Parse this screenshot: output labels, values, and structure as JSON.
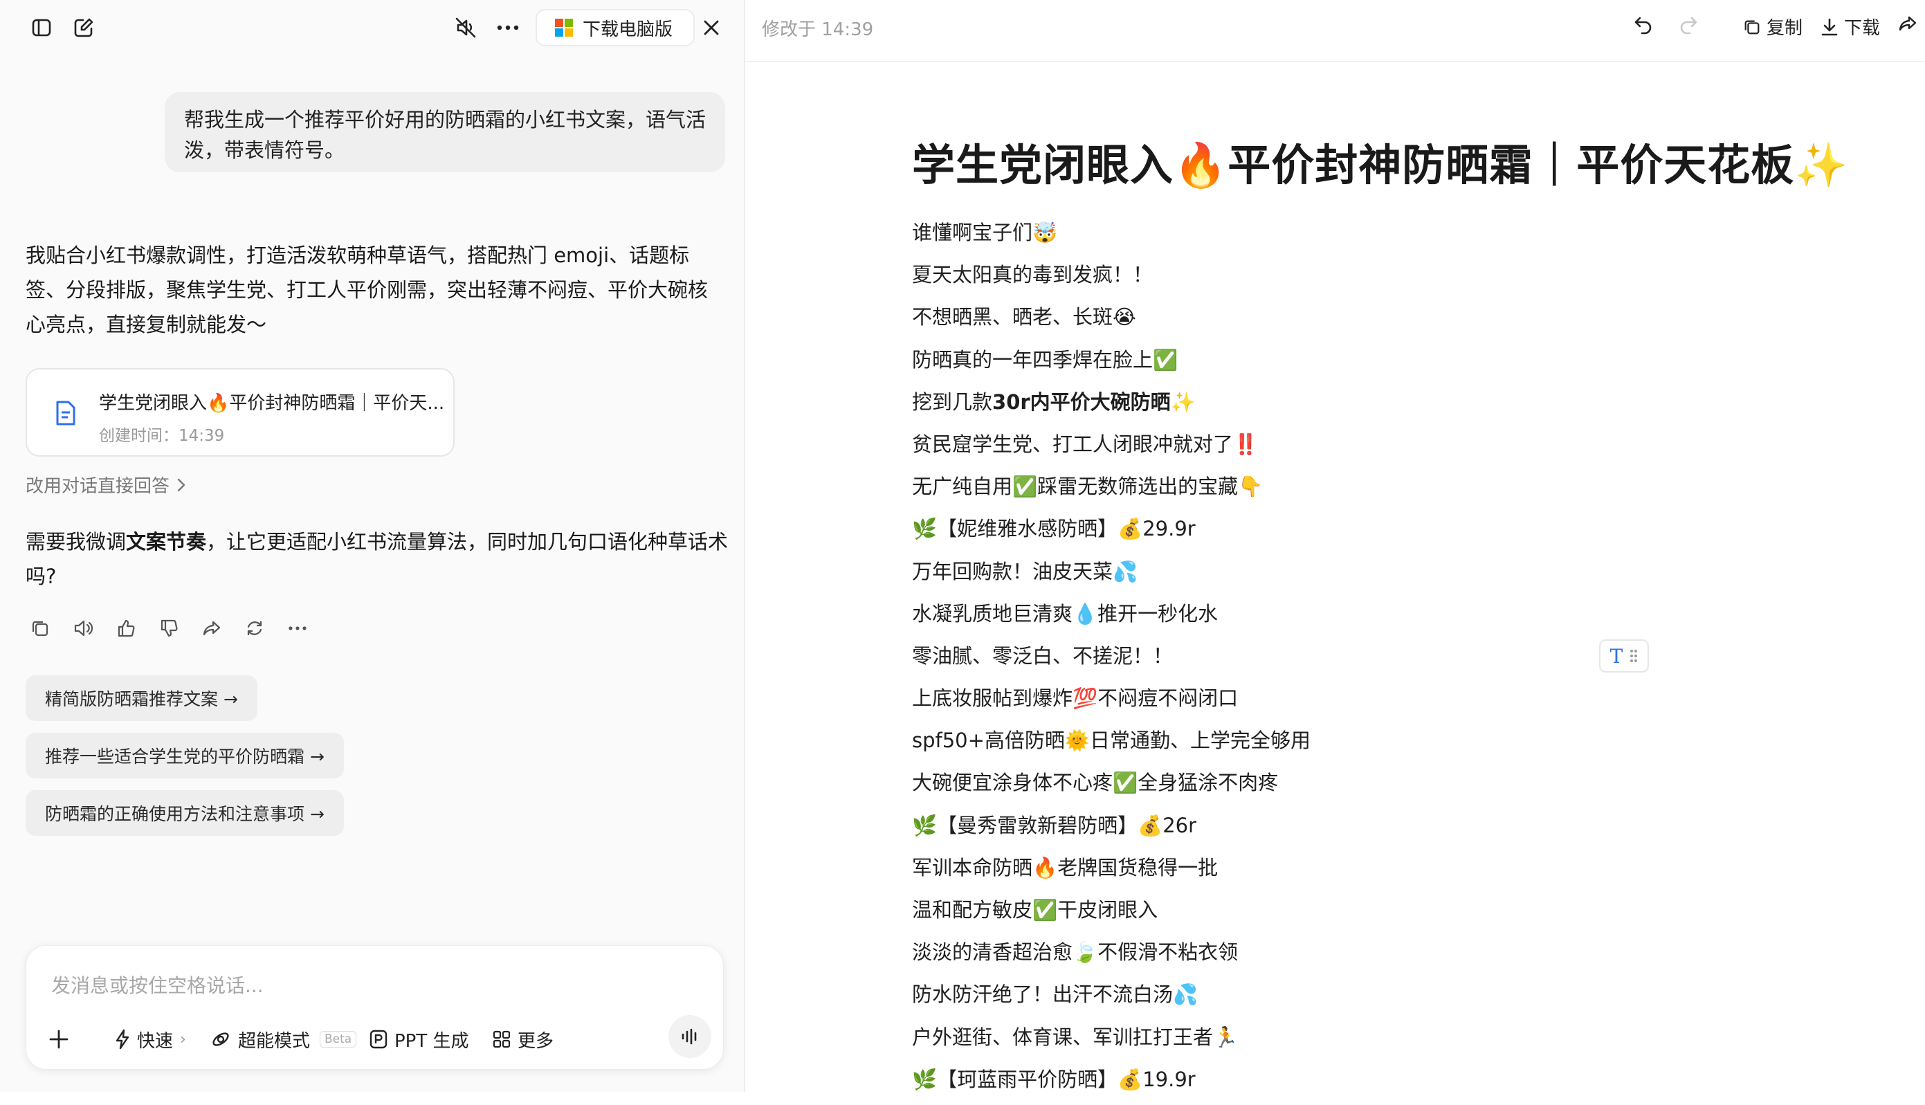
{
  "left": {
    "download_label": "下载电脑版",
    "user_message": "帮我生成一个推荐平价好用的防晒霜的小红书文案，语气活泼，带表情符号。",
    "reply_text": "我贴合小红书爆款调性，打造活泼软萌种草语气，搭配热门 emoji、话题标签、分段排版，聚焦学生党、打工人平价刚需，突出轻薄不闷痘、平价大碗核心亮点，直接复制就能发～",
    "doc_card": {
      "title": "学生党闭眼入🔥平价封神防晒霜｜平价天...",
      "subtitle": "创建时间：14:39"
    },
    "redo_label": "改用对话直接回答",
    "question_pre": "需要我微调",
    "question_bold": "文案节奏",
    "question_post": "，让它更适配小红书流量算法，同时加几句口语化种草话术吗?",
    "suggestions": [
      "精简版防晒霜推荐文案 →",
      "推荐一些适合学生党的平价防晒霜 →",
      "防晒霜的正确使用方法和注意事项 →"
    ],
    "composer": {
      "placeholder": "发消息或按住空格说话...",
      "fast_label": "快速",
      "super_label": "超能模式",
      "beta_label": "Beta",
      "ppt_label": "PPT 生成",
      "more_label": "更多"
    }
  },
  "right": {
    "modified": "修改于 14:39",
    "copy_label": "复制",
    "download_label": "下载",
    "doc_title": "学生党闭眼入🔥平价封神防晒霜｜平价天花板✨",
    "lines": [
      {
        "text": "谁懂啊宝子们🤯"
      },
      {
        "text": "夏天太阳真的毒到发疯！！"
      },
      {
        "text": "不想晒黑、晒老、长斑😭"
      },
      {
        "text": "防晒真的一年四季焊在脸上✅"
      },
      {
        "pre": "挖到几款",
        "bold": "30r内平价大碗防晒",
        "post": "✨"
      },
      {
        "text": "贫民窟学生党、打工人闭眼冲就对了‼️"
      },
      {
        "text": "无广纯自用✅踩雷无数筛选出的宝藏👇"
      },
      {
        "text": "🌿【妮维雅水感防晒】💰29.9r"
      },
      {
        "text": "万年回购款！油皮天菜💦"
      },
      {
        "text": "水凝乳质地巨清爽💧推开一秒化水"
      },
      {
        "text": "零油腻、零泛白、不搓泥！！"
      },
      {
        "text": "上底妆服帖到爆炸💯不闷痘不闷闭口"
      },
      {
        "text": "spf50+高倍防晒🌞日常通勤、上学完全够用"
      },
      {
        "text": "大碗便宜涂身体不心疼✅全身猛涂不肉疼"
      },
      {
        "text": "🌿【曼秀雷敦新碧防晒】💰26r"
      },
      {
        "text": "军训本命防晒🔥老牌国货稳得一批"
      },
      {
        "text": "温和配方敏皮✅干皮闭眼入"
      },
      {
        "text": "淡淡的清香超治愈🍃不假滑不粘衣领"
      },
      {
        "text": "防水防汗绝了！出汗不流白汤💦"
      },
      {
        "text": "户外逛街、体育课、军训扛打王者🏃"
      },
      {
        "text": "🌿【珂蓝雨平价防晒】💰19.9r"
      }
    ]
  }
}
